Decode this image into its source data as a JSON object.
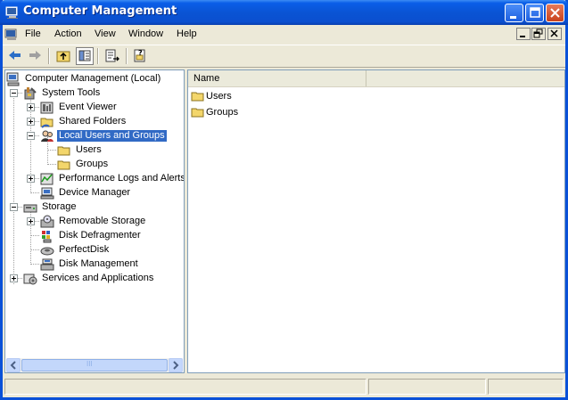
{
  "window": {
    "title": "Computer Management"
  },
  "menu": {
    "items": [
      "File",
      "Action",
      "View",
      "Window",
      "Help"
    ]
  },
  "toolbar": {
    "buttons": [
      "back-icon",
      "forward-icon",
      "up-folder-icon",
      "show-hide-tree-icon",
      "export-list-icon",
      "help-icon"
    ]
  },
  "tree": {
    "items": [
      {
        "label": "Computer Management (Local)",
        "icon": "computer-management-icon"
      },
      {
        "label": "System Tools",
        "icon": "system-tools-icon"
      },
      {
        "label": "Event Viewer",
        "icon": "event-viewer-icon"
      },
      {
        "label": "Shared Folders",
        "icon": "shared-folders-icon"
      },
      {
        "label": "Local Users and Groups",
        "icon": "local-users-icon",
        "selected": true
      },
      {
        "label": "Users",
        "icon": "folder-icon"
      },
      {
        "label": "Groups",
        "icon": "folder-icon"
      },
      {
        "label": "Performance Logs and Alerts",
        "icon": "performance-logs-icon"
      },
      {
        "label": "Device Manager",
        "icon": "device-manager-icon"
      },
      {
        "label": "Storage",
        "icon": "storage-icon"
      },
      {
        "label": "Removable Storage",
        "icon": "removable-storage-icon"
      },
      {
        "label": "Disk Defragmenter",
        "icon": "disk-defragmenter-icon"
      },
      {
        "label": "PerfectDisk",
        "icon": "perfectdisk-icon"
      },
      {
        "label": "Disk Management",
        "icon": "disk-management-icon"
      },
      {
        "label": "Services and Applications",
        "icon": "services-applications-icon"
      }
    ],
    "scrollbar_thumb_label": "III"
  },
  "list": {
    "columns": [
      "Name"
    ],
    "rows": [
      {
        "name": "Users",
        "icon": "folder-icon"
      },
      {
        "name": "Groups",
        "icon": "folder-icon"
      }
    ]
  },
  "colors": {
    "titlebar": "#0a54d4",
    "selection": "#316ac5"
  }
}
